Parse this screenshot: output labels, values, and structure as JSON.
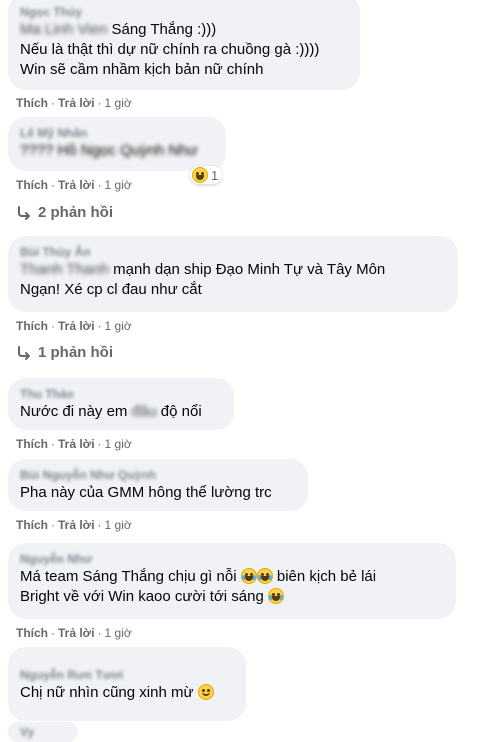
{
  "actions": {
    "like": "Thích",
    "reply": "Trả lời",
    "sep": "·",
    "time": "1 giờ"
  },
  "comments": [
    {
      "author": "Ngọc Thúy",
      "line_prefix_blur": "Ma Linh Vien",
      "line1_rest": "Sáng Thắng :)))",
      "line2": "Nếu là thật thì dự nữ chính ra chuồng gà :))))",
      "line3": "Win sẽ cầm nhầm kịch bản nữ chính"
    },
    {
      "author": "Lê Mỹ Nhân",
      "line1_blur": "???? Hồ Ngọc Quỳnh Như",
      "reaction_count": "1",
      "replies_label": "2 phản hồi"
    },
    {
      "author": "Bùi Thùy Ân",
      "tag_blur": "Thanh Thanh",
      "line1_rest": "mạnh dạn ship Đạo Minh Tự và Tây Môn",
      "line2": "Ngạn! Xé cp cl đau như cắt",
      "replies_label": "1 phản hồi"
    },
    {
      "author": "Thu Thảo",
      "line1_a": "Nước đi này em",
      "line1_blur": "đâu",
      "line1_b": "độ nổi"
    },
    {
      "author": "Bùi Nguyễn Như Quỳnh",
      "line1": "Pha này của GMM hông thể lường trc"
    },
    {
      "author": "Nguyễn Như",
      "line1": "Má team Sáng Thắng chịu gì nỗi",
      "line1_b": "biên kịch bẻ lái",
      "line2": "Bright về với Win kaoo cười tới sáng"
    },
    {
      "author": "Nguyễn Rưn Tươi",
      "line1": "Chị nữ nhìn cũng xinh mừ"
    },
    {
      "author": "Vy"
    }
  ],
  "icons": {
    "laugh": "laugh-cry-emoji",
    "smile": "smile-emoji",
    "reply_arrow": "reply-arrow-icon"
  }
}
